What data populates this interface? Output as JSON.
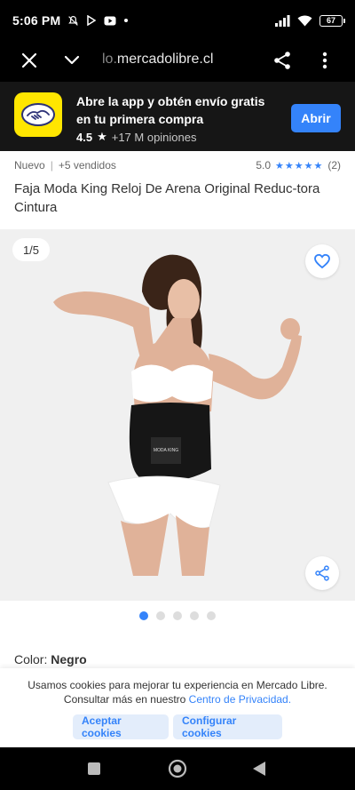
{
  "status_bar": {
    "time": "5:06 PM",
    "battery": "67"
  },
  "browser": {
    "url_faded": "lo.",
    "url_domain": "mercadolibre.cl"
  },
  "app_banner": {
    "title": "Abre la app y obtén envío gratis en tu primera compra",
    "rating": "4.5",
    "reviews": "+17 M opiniones",
    "open_label": "Abrir"
  },
  "product": {
    "condition": "Nuevo",
    "sold": "+5 vendidos",
    "rating_value": "5.0",
    "rating_count": "(2)",
    "title": "Faja Moda King Reloj De Arena Original Reduc-tora Cintura",
    "image_counter": "1/5",
    "belt_text": "MODA KING"
  },
  "color": {
    "label": "Color:",
    "value": "Negro"
  },
  "cookie_banner": {
    "text": "Usamos cookies para mejorar tu experiencia en Mercado Libre. Consultar más en nuestro",
    "link": "Centro de Privacidad.",
    "accept_label": "Aceptar cookies",
    "configure_label": "Configurar cookies"
  },
  "colors": {
    "accent": "#3483fa",
    "brand_yellow": "#ffe600"
  },
  "icons": [
    "close-icon",
    "chevron-down-icon",
    "share-icon",
    "more-vert-icon",
    "heart-icon",
    "star-icon",
    "handshake-icon"
  ]
}
